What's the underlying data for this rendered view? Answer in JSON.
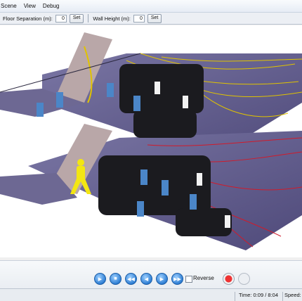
{
  "menu": {
    "items": [
      "Scene",
      "View",
      "Debug"
    ]
  },
  "toolbar": {
    "floor_separation_label": "Floor Separation (m):",
    "floor_separation_value": "0",
    "wall_height_label": "Wall Height (m):",
    "wall_height_value": "0",
    "set_label": "Set"
  },
  "playback": {
    "reverse_label": "Reverse",
    "reverse_checked": false
  },
  "status": {
    "time": "Time: 0:09 / 8:04",
    "speed": "Speed:"
  },
  "colors": {
    "floor": "#5f5a86",
    "trail_upper": "#e0c300",
    "trail_lower": "#d11a2a",
    "highlight_agent": "#f3e612",
    "play_button": "#2f7fd4"
  },
  "icons": [
    "play-icon",
    "stop-icon",
    "rewind-icon",
    "step-back-icon",
    "step-forward-icon",
    "fast-forward-icon",
    "record-icon"
  ]
}
